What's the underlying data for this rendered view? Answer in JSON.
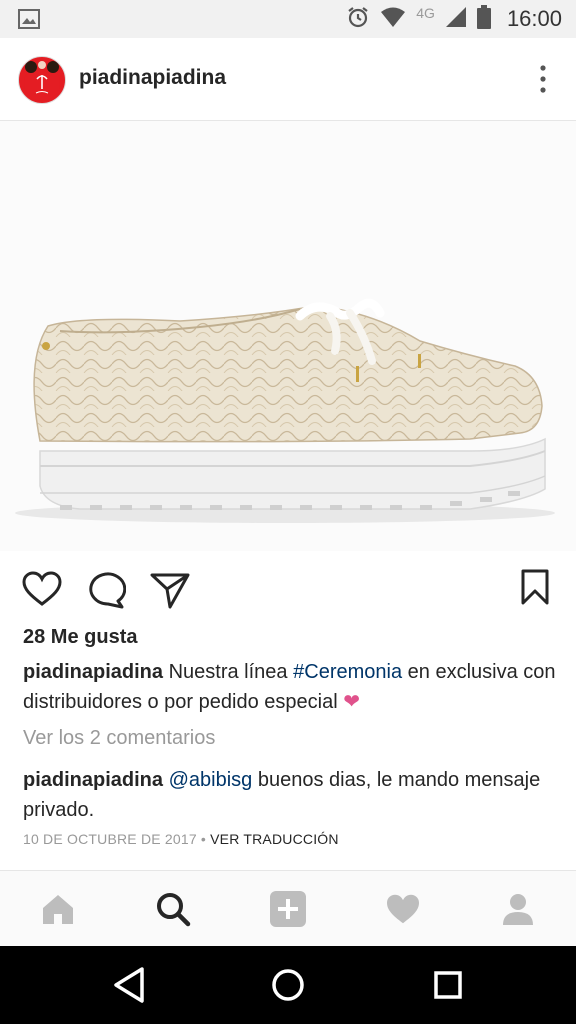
{
  "status_bar": {
    "network": "4G",
    "time": "16:00",
    "icons": [
      "image-icon",
      "alarm-icon",
      "wifi-icon",
      "signal-icon",
      "battery-icon"
    ]
  },
  "post": {
    "username": "piadinapiadina",
    "likes": "28 Me gusta",
    "caption": {
      "username": "piadinapiadina",
      "text_before_tag": "Nuestra línea",
      "hashtag": "#Ceremonia",
      "text_after_tag": "en exclusiva con distribuidores o por pedido especial",
      "emoji": "❤"
    },
    "view_comments": "Ver los 2 comentarios",
    "comment": {
      "username": "piadinapiadina",
      "mention": "@abibisg",
      "text": "buenos dias, le mando mensaje privado."
    },
    "date": "10 DE OCTUBRE DE 2017",
    "separator": "•",
    "translate": "VER TRADUCCIÓN"
  },
  "actions": [
    "like-icon",
    "comment-icon",
    "share-icon",
    "bookmark-icon"
  ],
  "tabs": [
    "home-icon",
    "search-icon",
    "add-icon",
    "activity-icon",
    "profile-icon"
  ],
  "system_nav": [
    "back-icon",
    "home-circle-icon",
    "recents-icon"
  ],
  "colors": {
    "hashtag": "#003569",
    "heart": "#e0528c",
    "muted": "#999999",
    "avatar_red": "#e41d23"
  }
}
